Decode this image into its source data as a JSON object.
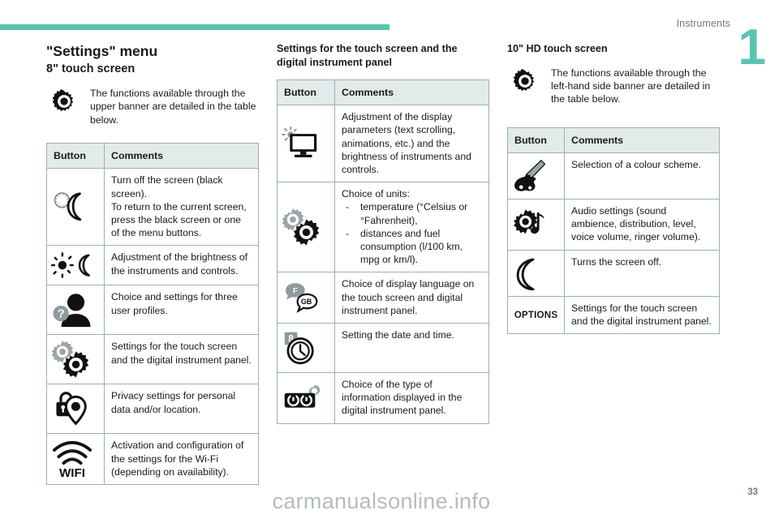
{
  "header": {
    "chapter_label": "Instruments",
    "chapter_number": "1"
  },
  "footer": {
    "watermark": "carmanualsonline.info",
    "page_number": "33"
  },
  "colors": {
    "accent": "#5bc4b1",
    "table_header_bg": "#e3eaea",
    "table_border": "#9bb0b4"
  },
  "column1": {
    "title": "\"Settings\" menu",
    "subtitle": "8\" touch screen",
    "intro": "The functions available through the upper banner are detailed in the table below.",
    "intro_icon": "gear-icon",
    "table": {
      "headers": [
        "Button",
        "Comments"
      ],
      "rows": [
        {
          "icon": "moon-sun-sleep-icon",
          "comment": "Turn off the screen (black screen).\nTo return to the current screen, press the black screen or one of the menu buttons."
        },
        {
          "icon": "brightness-day-night-icon",
          "comment": "Adjustment of the brightness of the instruments and controls."
        },
        {
          "icon": "user-profile-question-icon",
          "comment": "Choice and settings for three user profiles."
        },
        {
          "icon": "double-gear-icon",
          "comment": "Settings for the touch screen and the digital instrument panel."
        },
        {
          "icon": "lock-location-pin-icon",
          "comment": "Privacy settings for personal data and/or location."
        },
        {
          "icon": "wifi-icon",
          "icon_text": "WIFI",
          "comment": "Activation and configuration of the settings for the Wi-Fi (depending on availability)."
        }
      ]
    }
  },
  "column2": {
    "heading": "Settings for the touch screen and the digital instrument panel",
    "table": {
      "headers": [
        "Button",
        "Comments"
      ],
      "rows": [
        {
          "icon": "monitor-brightness-icon",
          "comment": "Adjustment of the display parameters (text scrolling, animations, etc.) and the brightness of instruments and controls."
        },
        {
          "icon": "double-gear-icon",
          "comment_lead": "Choice of units:",
          "comment_items": [
            "temperature (°Celsius or °Fahrenheit),",
            "distances and fuel consumption (l/100 km, mpg or km/l)."
          ]
        },
        {
          "icon": "language-bubbles-icon",
          "icon_text_1": "F",
          "icon_text_2": "GB",
          "comment": "Choice of display language on the touch screen and digital instrument panel."
        },
        {
          "icon": "calendar-clock-icon",
          "icon_text": "8",
          "comment": "Setting the date and time."
        },
        {
          "icon": "instrument-cluster-gear-icon",
          "comment": "Choice of the type of information displayed in the digital instrument panel."
        }
      ]
    }
  },
  "column3": {
    "heading": "10\" HD touch screen",
    "intro": "The functions available through the left-hand side banner are detailed in the table below.",
    "intro_icon": "gear-icon",
    "table": {
      "headers": [
        "Button",
        "Comments"
      ],
      "rows": [
        {
          "icon": "palette-brush-icon",
          "comment": "Selection of a colour scheme."
        },
        {
          "icon": "gear-music-note-icon",
          "comment": "Audio settings (sound ambience, distribution, level, voice volume, ringer volume)."
        },
        {
          "icon": "moon-icon",
          "comment": "Turns the screen off."
        },
        {
          "icon": "options-text-icon",
          "icon_text": "OPTIONS",
          "comment": "Settings for the touch screen and the digital instrument panel."
        }
      ]
    }
  }
}
